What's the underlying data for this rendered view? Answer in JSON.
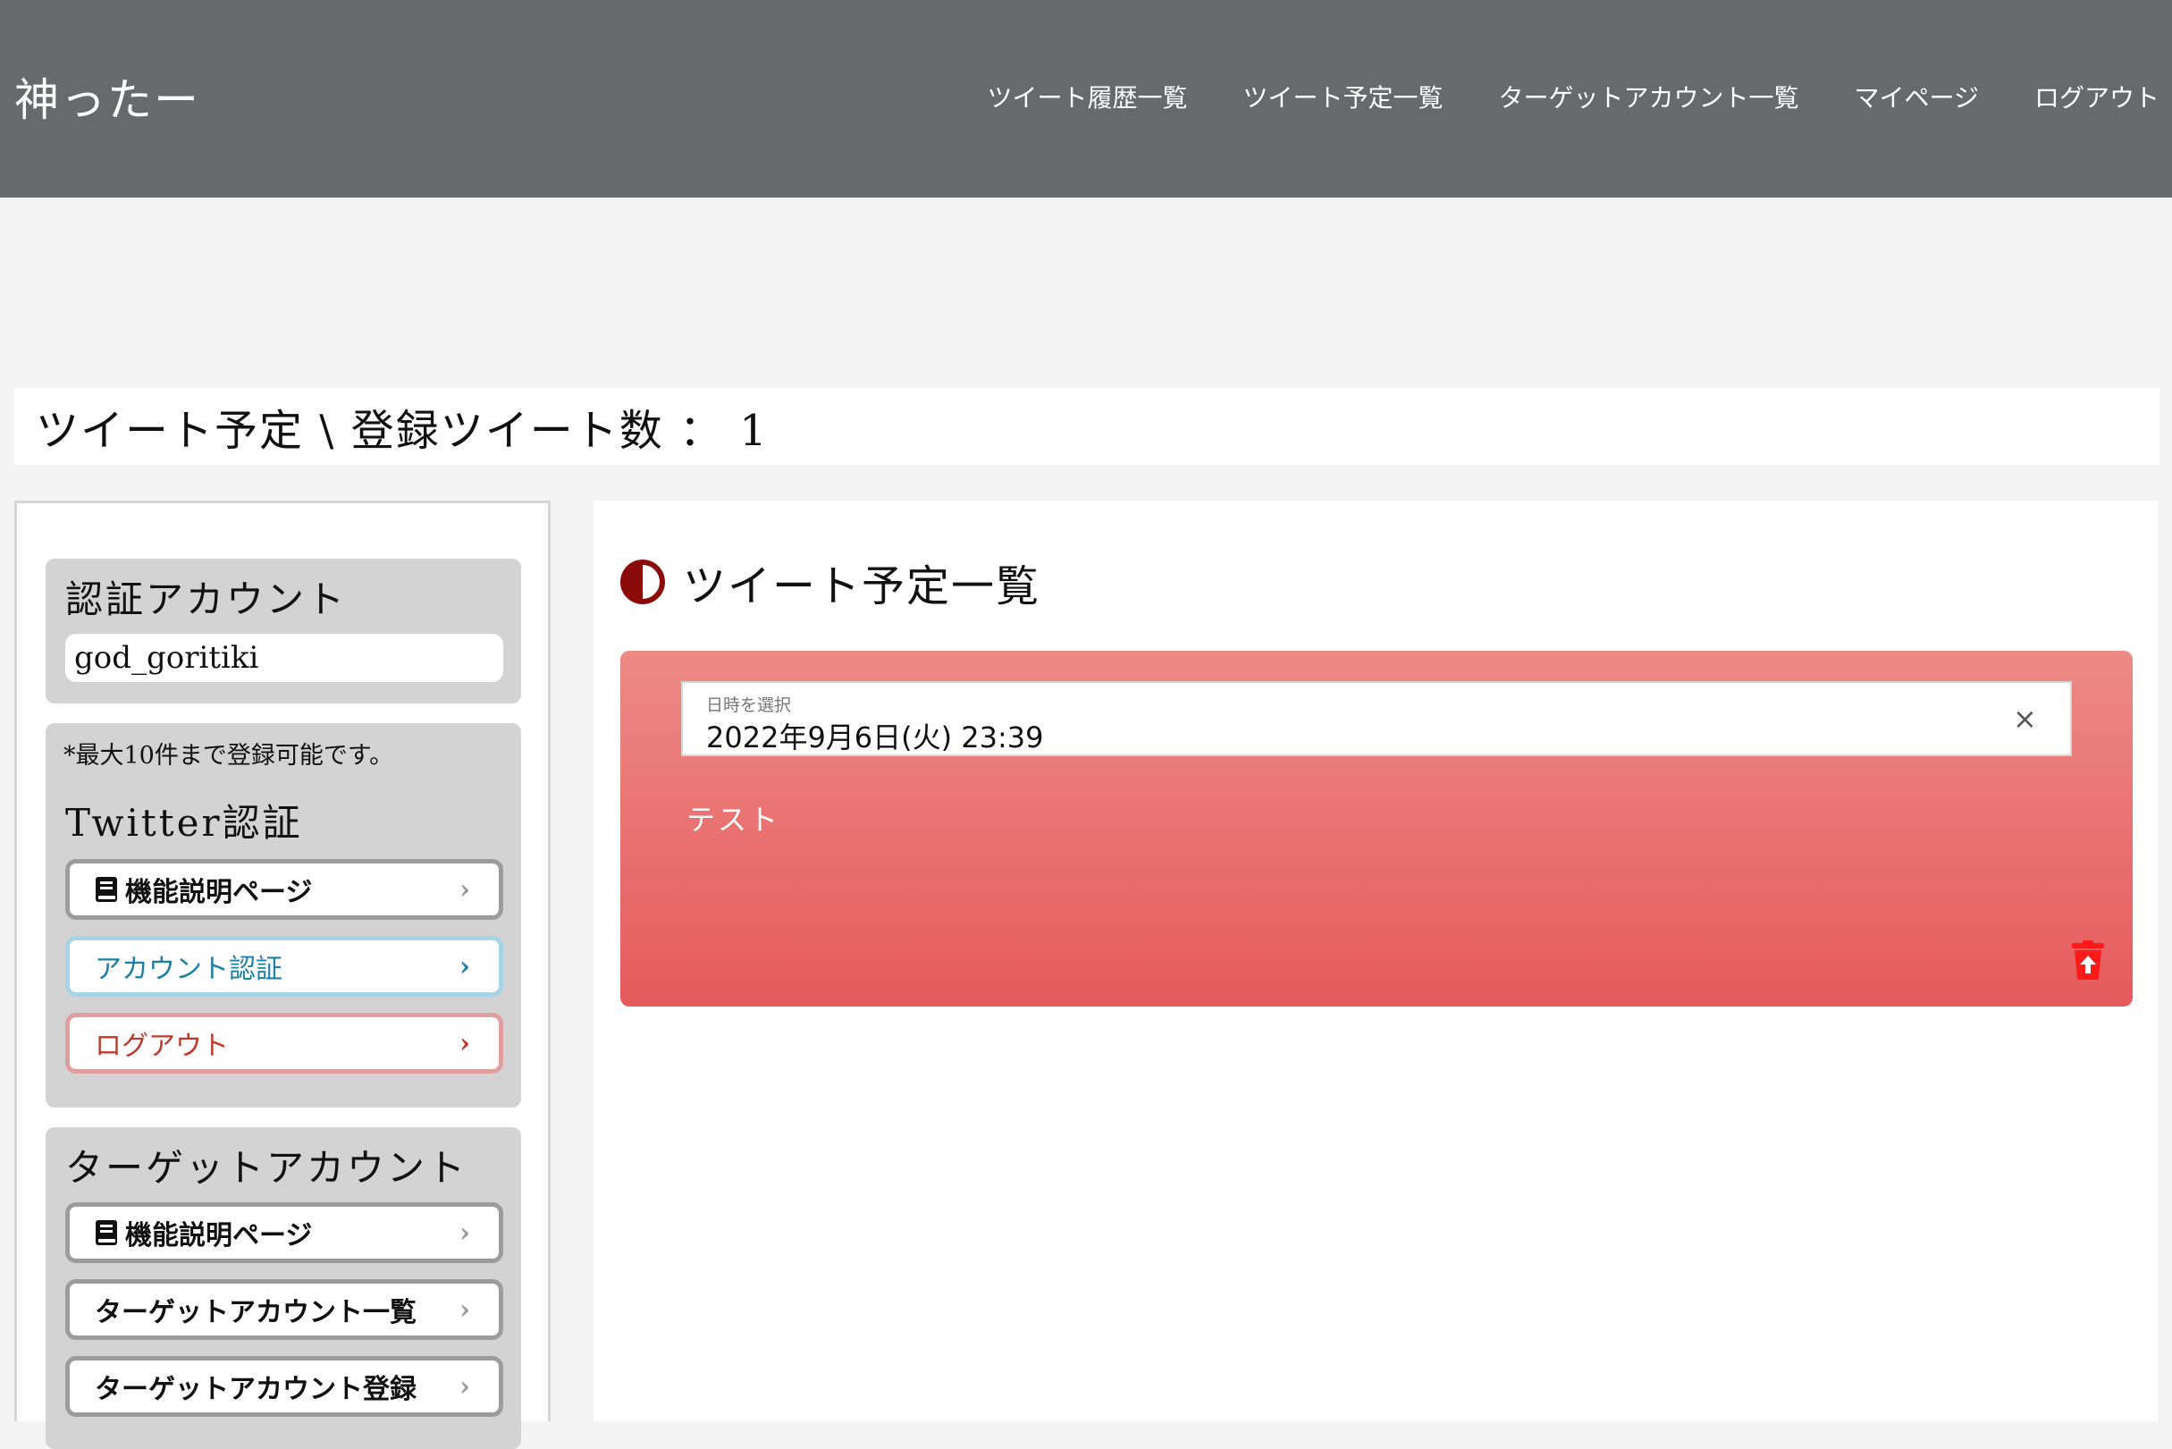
{
  "header": {
    "brand": "神ったー",
    "nav": [
      {
        "label": "ツイート履歴一覧"
      },
      {
        "label": "ツイート予定一覧"
      },
      {
        "label": "ターゲットアカウント一覧"
      },
      {
        "label": "マイページ"
      },
      {
        "label": "ログアウト"
      }
    ]
  },
  "page_title": "ツイート予定 \\ 登録ツイート数 ： 1",
  "sidebar": {
    "auth_account": {
      "heading": "認証アカウント",
      "account_name": "god_goritiki"
    },
    "twitter": {
      "note": "*最大10件まで登録可能です。",
      "heading": "Twitter認証",
      "buttons": [
        {
          "label": "機能説明ページ",
          "style": "default",
          "icon": "book-icon"
        },
        {
          "label": "アカウント認証",
          "style": "blue"
        },
        {
          "label": "ログアウト",
          "style": "red"
        }
      ]
    },
    "target": {
      "heading": "ターゲットアカウント",
      "buttons": [
        {
          "label": "機能説明ページ",
          "style": "default",
          "icon": "book-icon"
        },
        {
          "label": "ターゲットアカウント一覧",
          "style": "default"
        },
        {
          "label": "ターゲットアカウント登録",
          "style": "default"
        }
      ]
    }
  },
  "main": {
    "section_icon": "half-circle-icon",
    "section_title": "ツイート予定一覧",
    "tweets": [
      {
        "datetime_label": "日時を選択",
        "datetime_value": "2022年9月6日(火) 23:39",
        "text": "テスト"
      }
    ]
  },
  "colors": {
    "header_bg": "#68696b",
    "accent_dark_red": "#8b0a0a",
    "card_gradient_top": "#ec8a86",
    "card_gradient_bottom": "#e65a5c",
    "trash_red": "#ff1a1a",
    "auth_blue": "#1b7fa6",
    "logout_red": "#c0392b"
  }
}
